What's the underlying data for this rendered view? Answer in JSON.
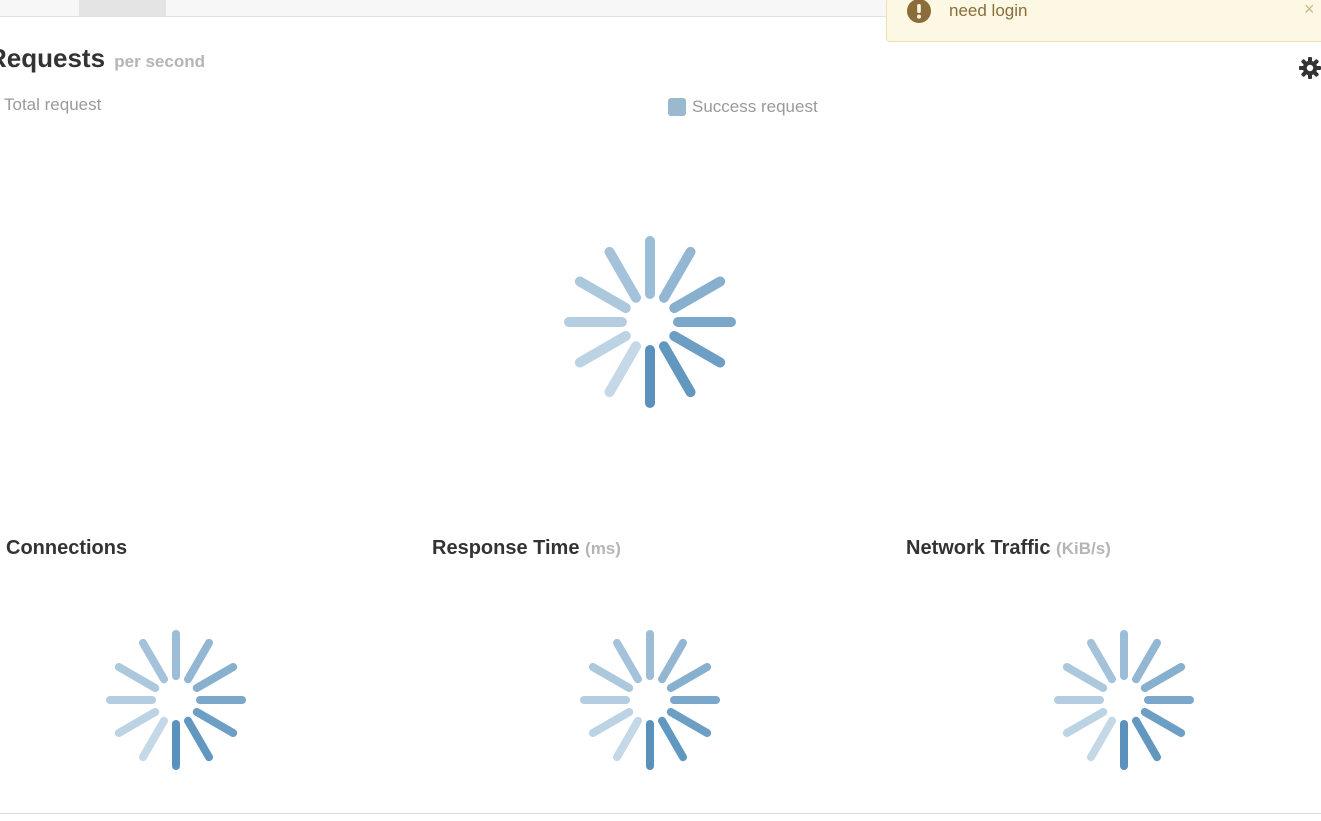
{
  "header": {
    "title": "Requests",
    "title_unit": "per second",
    "legend_left": "Total request",
    "legend_success": "Success request",
    "legend_success_color": "#9ab9cf",
    "settings_icon": "gear-icon"
  },
  "toast": {
    "icon": "exclamation-circle-icon",
    "message": "need login",
    "close_label": "×",
    "background": "#fcf8e3"
  },
  "panels": [
    {
      "title": "Connections",
      "unit": ""
    },
    {
      "title": "Response Time",
      "unit": "(ms)"
    },
    {
      "title": "Network Traffic",
      "unit": "(KiB/s)"
    }
  ],
  "spinner_color": "#5a92bd"
}
